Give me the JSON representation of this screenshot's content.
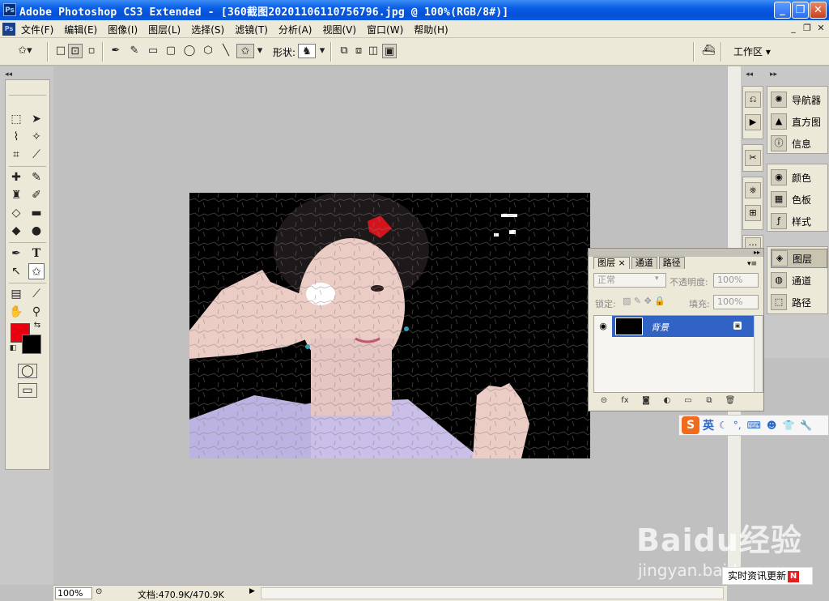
{
  "window": {
    "title": "Adobe Photoshop CS3 Extended - [360截图20201106110756796.jpg @ 100%(RGB/8#)]",
    "app_icon": "Ps",
    "minimize": "_",
    "maximize": "❐",
    "close": "✕"
  },
  "menubar": {
    "doc_icon": "Ps",
    "items": [
      "文件(F)",
      "编辑(E)",
      "图像(I)",
      "图层(L)",
      "选择(S)",
      "滤镜(T)",
      "分析(A)",
      "视图(V)",
      "窗口(W)",
      "帮助(H)"
    ]
  },
  "optionsbar": {
    "shape_label": "形状:",
    "workspace_label": "工作区 ▾"
  },
  "colors": {
    "foreground": "#e60010",
    "background": "#000000",
    "layer_selected": "#3163c5"
  },
  "panels": {
    "group1": [
      "导航器",
      "直方图",
      "信息"
    ],
    "group2": [
      "颜色",
      "色板",
      "样式"
    ],
    "group3": [
      "图层",
      "通道",
      "路径"
    ]
  },
  "layers_panel": {
    "tabs": [
      "图层 ×",
      "通道",
      "路径"
    ],
    "blend_mode": "正常",
    "opacity_label": "不透明度:",
    "opacity_value": "100%",
    "lock_label": "锁定:",
    "fill_label": "填充:",
    "fill_value": "100%",
    "layer_name": "背景"
  },
  "statusbar": {
    "zoom": "100%",
    "doc_info": "文档:470.9K/470.9K"
  },
  "ime": {
    "mode": "英"
  },
  "watermark": {
    "brand": "Baidu经验",
    "url": "jingyan.baidu.com",
    "news": "实时资讯更新"
  }
}
